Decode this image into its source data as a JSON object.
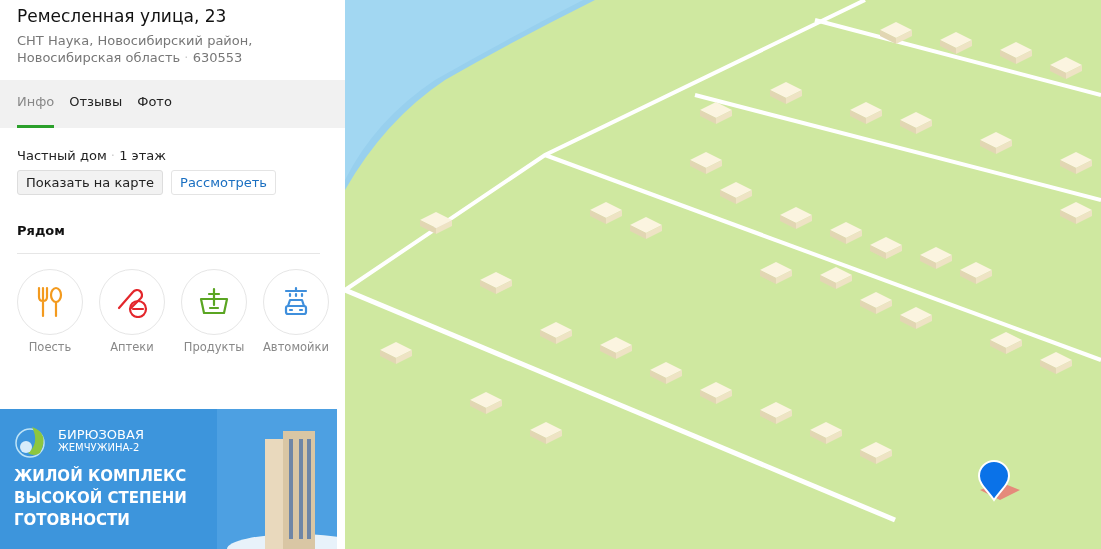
{
  "place": {
    "title": "Ремесленная улица, 23",
    "address": "СНТ Наука, Новосибирский район,",
    "address_line2": "Новосибирская область",
    "separator": "·",
    "postcode": "630553"
  },
  "tabs": [
    {
      "label": "Инфо",
      "selected": true
    },
    {
      "label": "Отзывы",
      "selected": false
    },
    {
      "label": "Фото",
      "selected": false
    }
  ],
  "info": {
    "type": "Частный дом",
    "separator": "·",
    "floors": "1 этаж"
  },
  "buttons": [
    {
      "label": "Показать на карте",
      "kind": "primary"
    },
    {
      "label": "Рассмотреть",
      "kind": "link"
    }
  ],
  "nearby": {
    "title": "Рядом",
    "items": [
      {
        "label": "Поесть",
        "kind": "food",
        "color": "#f39a1e"
      },
      {
        "label": "Аптеки",
        "kind": "pharmacy",
        "color": "#e3262b"
      },
      {
        "label": "Продукты",
        "kind": "grocery",
        "color": "#5aa522"
      },
      {
        "label": "Автомойки",
        "kind": "carwash",
        "color": "#3f8fdc"
      }
    ]
  },
  "banner": {
    "brand": "БИРЮЗОВАЯ",
    "brand_line2": "ЖЕМЧУЖИНА-2",
    "headline": [
      "ЖИЛОЙ КОМПЛЕКС",
      "ВЫСОКОЙ СТЕПЕНИ",
      "ГОТОВНОСТИ"
    ]
  }
}
